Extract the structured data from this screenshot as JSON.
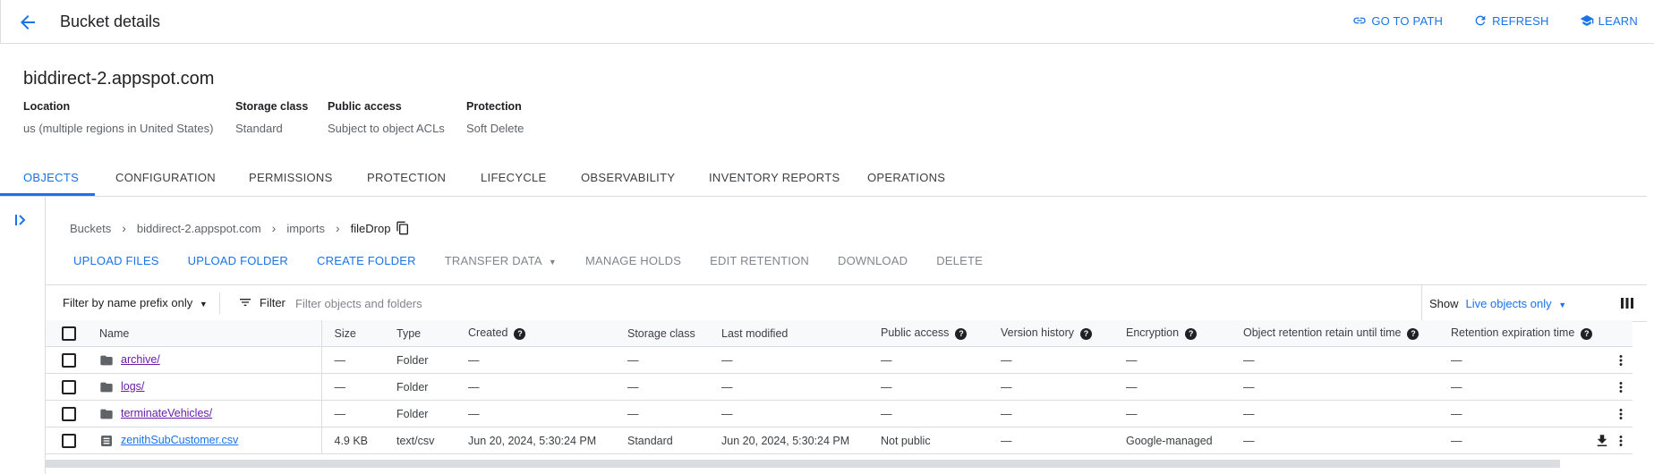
{
  "header": {
    "title": "Bucket details",
    "actions": {
      "go_to_path": "GO TO PATH",
      "refresh": "REFRESH",
      "learn": "LEARN"
    }
  },
  "bucket": {
    "name": "biddirect-2.appspot.com",
    "location_label": "Location",
    "location_value": "us (multiple regions in United States)",
    "storage_class_label": "Storage class",
    "storage_class_value": "Standard",
    "public_access_label": "Public access",
    "public_access_value": "Subject to object ACLs",
    "protection_label": "Protection",
    "protection_value": "Soft Delete"
  },
  "tabs": [
    "OBJECTS",
    "CONFIGURATION",
    "PERMISSIONS",
    "PROTECTION",
    "LIFECYCLE",
    "OBSERVABILITY",
    "INVENTORY REPORTS",
    "OPERATIONS"
  ],
  "breadcrumb": [
    "Buckets",
    "biddirect-2.appspot.com",
    "imports",
    "fileDrop"
  ],
  "actions": {
    "upload_files": "UPLOAD FILES",
    "upload_folder": "UPLOAD FOLDER",
    "create_folder": "CREATE FOLDER",
    "transfer_data": "TRANSFER DATA",
    "manage_holds": "MANAGE HOLDS",
    "edit_retention": "EDIT RETENTION",
    "download": "DOWNLOAD",
    "delete": "DELETE"
  },
  "filter": {
    "prefix_mode": "Filter by name prefix only",
    "label": "Filter",
    "placeholder": "Filter objects and folders",
    "show_label": "Show",
    "show_value": "Live objects only"
  },
  "columns": [
    "Name",
    "Size",
    "Type",
    "Created",
    "Storage class",
    "Last modified",
    "Public access",
    "Version history",
    "Encryption",
    "Object retention retain until time",
    "Retention expiration time"
  ],
  "rows": [
    {
      "name": "archive/",
      "size": "—",
      "type": "Folder",
      "created": "—",
      "storage_class": "—",
      "last_modified": "—",
      "public_access": "—",
      "version_history": "—",
      "encryption": "—",
      "retain_until": "—",
      "retention_expiration": "—"
    },
    {
      "name": "logs/",
      "size": "—",
      "type": "Folder",
      "created": "—",
      "storage_class": "—",
      "last_modified": "—",
      "public_access": "—",
      "version_history": "—",
      "encryption": "—",
      "retain_until": "—",
      "retention_expiration": "—"
    },
    {
      "name": "terminateVehicles/",
      "size": "—",
      "type": "Folder",
      "created": "—",
      "storage_class": "—",
      "last_modified": "—",
      "public_access": "—",
      "version_history": "—",
      "encryption": "—",
      "retain_until": "—",
      "retention_expiration": "—"
    },
    {
      "name": "zenithSubCustomer.csv",
      "size": "4.9 KB",
      "type": "text/csv",
      "created": "Jun 20, 2024, 5:30:24 PM",
      "storage_class": "Standard",
      "last_modified": "Jun 20, 2024, 5:30:24 PM",
      "public_access": "Not public",
      "version_history": "—",
      "encryption": "Google-managed",
      "retain_until": "—",
      "retention_expiration": "—"
    }
  ],
  "colors": {
    "accent": "#1a73e8",
    "visited_link": "#681da8",
    "border": "#dadce0"
  }
}
